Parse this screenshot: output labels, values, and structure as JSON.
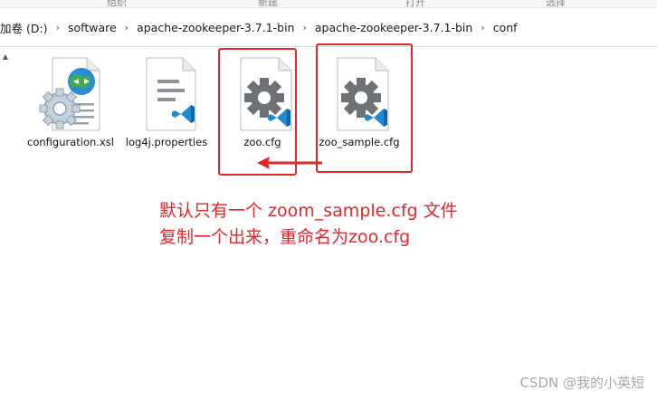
{
  "ribbon": {
    "items": [
      "组织",
      "新建",
      "打开",
      "选择"
    ]
  },
  "breadcrumb": {
    "items": [
      "加卷 (D:)",
      "software",
      "apache-zookeeper-3.7.1-bin",
      "apache-zookeeper-3.7.1-bin",
      "conf"
    ],
    "separator": "›"
  },
  "files": [
    {
      "name": "configuration.xsl",
      "type": "xsl-stylesheet"
    },
    {
      "name": "log4j.properties",
      "type": "text-vscode"
    },
    {
      "name": "zoo.cfg",
      "type": "config-vscode"
    },
    {
      "name": "zoo_sample.cfg",
      "type": "config-vscode"
    }
  ],
  "annotation": {
    "line1": "默认只有一个 zoom_sample.cfg 文件",
    "line2": "复制一个出来，重命名为zoo.cfg"
  },
  "watermark": "CSDN @我的小英短",
  "colors": {
    "highlight": "#e4252b",
    "vscode_blue": "#1f8ad2",
    "gear_gray": "#6e7176"
  }
}
